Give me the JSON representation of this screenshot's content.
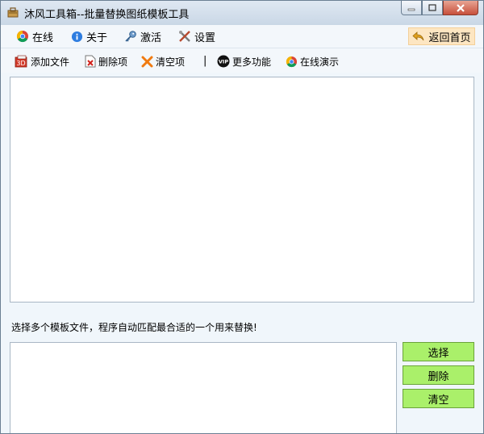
{
  "window": {
    "title": "沐风工具箱--批量替换图纸模板工具"
  },
  "menu": {
    "items": [
      {
        "label": "在线",
        "icon": "chrome-icon"
      },
      {
        "label": "关于",
        "icon": "info-icon"
      },
      {
        "label": "激活",
        "icon": "key-icon"
      },
      {
        "label": "设置",
        "icon": "tools-icon"
      }
    ],
    "back_label": "返回首页"
  },
  "toolbar": {
    "add_file": "添加文件",
    "delete_item": "删除项",
    "clear_items": "清空项",
    "separator": "|",
    "more_features": "更多功能",
    "online_demo": "在线演示"
  },
  "hint_text": "选择多个模板文件，程序自动匹配最合适的一个用来替换!",
  "template_buttons": {
    "select": "选择",
    "delete": "删除",
    "clear": "清空"
  },
  "colors": {
    "accent_green": "#aaf06a",
    "back_button_bg": "#fde6c2",
    "window_bg": "#f0f6fb"
  }
}
